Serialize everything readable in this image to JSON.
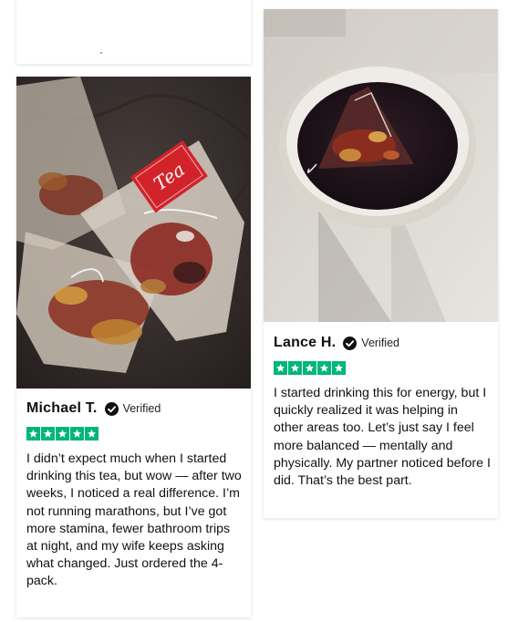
{
  "reviews": [
    {
      "name": "Michael T.",
      "verified_label": "Verified",
      "rating": 5,
      "photo_icon": "tea-bags-photo",
      "text": "I didn’t expect much when I started drinking this tea, but wow — after two weeks, I noticed a real difference. I’m not running marathons, but I’ve got more stamina, fewer bathroom trips at night, and my wife keeps asking what changed. Just ordered the 4-pack."
    },
    {
      "name": "Lance H.",
      "verified_label": "Verified",
      "rating": 5,
      "photo_icon": "tea-cup-photo",
      "text": "I started drinking this for energy, but I quickly realized it was helping in other areas too. Let’s just say I feel more balanced — mentally and physically. My partner noticed before I did. That’s the best part."
    }
  ],
  "colors": {
    "star_green": "#00b67a",
    "tag_red": "#d2232a"
  },
  "icons": [
    "verified-check-icon",
    "star-icon"
  ]
}
